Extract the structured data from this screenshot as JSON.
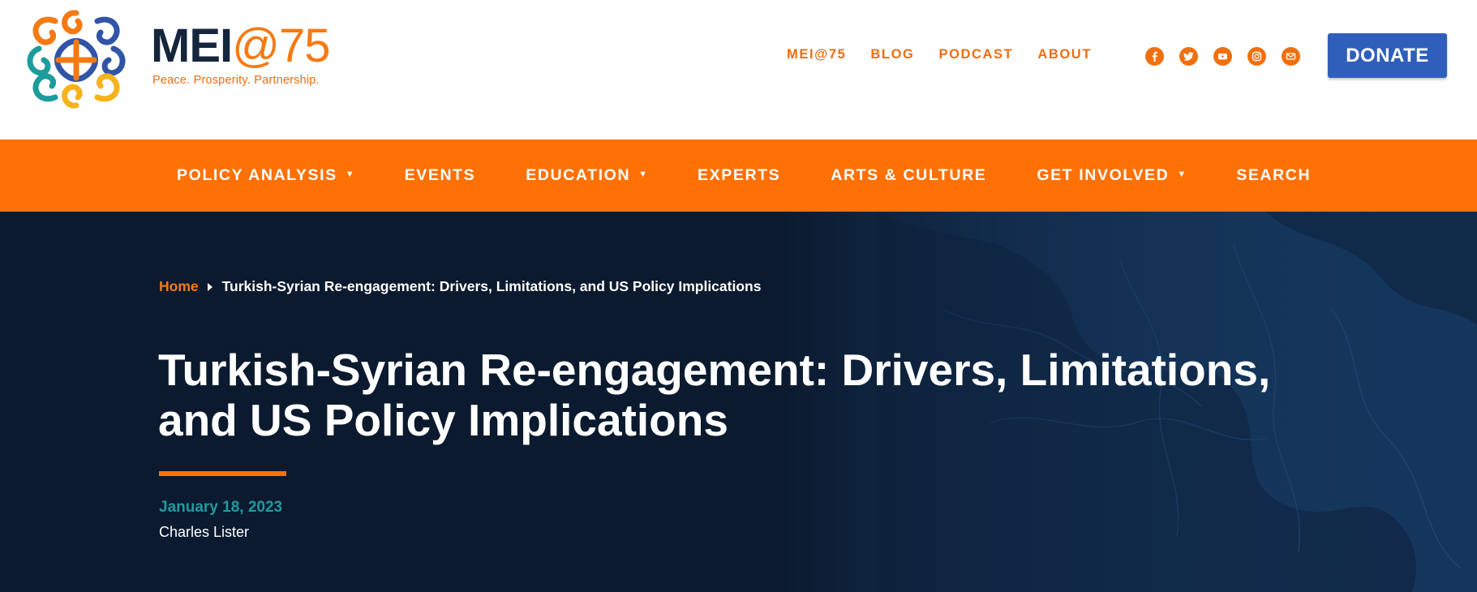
{
  "header": {
    "logo_name": "MEI",
    "logo_accent": "@75",
    "tagline": "Peace. Prosperity. Partnership.",
    "util_nav": [
      "MEI@75",
      "BLOG",
      "PODCAST",
      "ABOUT"
    ],
    "social_icons": [
      "facebook-icon",
      "twitter-icon",
      "youtube-icon",
      "instagram-icon",
      "email-icon"
    ],
    "donate_label": "DONATE"
  },
  "main_nav": {
    "items": [
      {
        "label": "POLICY ANALYSIS",
        "dropdown": true
      },
      {
        "label": "EVENTS",
        "dropdown": false
      },
      {
        "label": "EDUCATION",
        "dropdown": true
      },
      {
        "label": "EXPERTS",
        "dropdown": false
      },
      {
        "label": "ARTS & CULTURE",
        "dropdown": false
      },
      {
        "label": "GET INVOLVED",
        "dropdown": true
      },
      {
        "label": "SEARCH",
        "dropdown": false
      }
    ],
    "caret_glyph": "▼"
  },
  "hero": {
    "breadcrumb": {
      "home": "Home",
      "current": "Turkish-Syrian Re-engagement: Drivers, Limitations, and US Policy Implications"
    },
    "title": "Turkish-Syrian Re-engagement: Drivers, Limitations, and US Policy Implications",
    "date": "January 18, 2023",
    "author": "Charles Lister"
  },
  "colors": {
    "brand_orange": "#ff7105",
    "navy": "#0b1a2e",
    "donate_blue": "#2f5fbb",
    "teal": "#1f9aa0"
  }
}
